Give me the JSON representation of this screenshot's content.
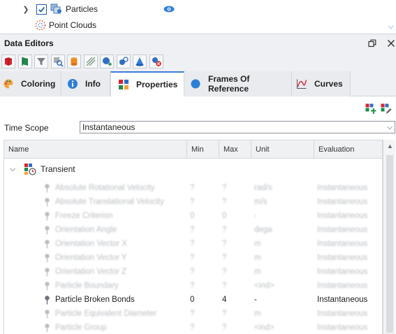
{
  "tree": {
    "items": [
      {
        "label": "Particles",
        "checked": true
      },
      {
        "label": "Point Clouds"
      }
    ]
  },
  "panel": {
    "title": "Data Editors"
  },
  "toolbar": {
    "buttons": [
      {
        "icon": "red-cube-icon"
      },
      {
        "icon": "green-flag-icon"
      },
      {
        "icon": "funnel-icon"
      },
      {
        "icon": "zoom-icon"
      },
      {
        "icon": "orange-cylinder-icon"
      },
      {
        "icon": "lines-icon"
      },
      {
        "icon": "add-node-icon"
      },
      {
        "icon": "link-icon"
      },
      {
        "icon": "cone-icon"
      },
      {
        "icon": "delete-icon"
      }
    ]
  },
  "tabs": [
    {
      "label": "Coloring",
      "active": false
    },
    {
      "label": "Info",
      "active": false
    },
    {
      "label": "Properties",
      "active": true
    },
    {
      "label": "Frames Of Reference",
      "active": false
    },
    {
      "label": "Curves",
      "active": false
    }
  ],
  "time_scope": {
    "label": "Time Scope",
    "value": "Instantaneous"
  },
  "grid": {
    "columns": [
      "Name",
      "Min",
      "Max",
      "Unit",
      "Evaluation"
    ],
    "group": "Transient",
    "rows": [
      {
        "name": "Absolute Rotational Velocity",
        "min": "?",
        "max": "?",
        "unit": "rad/s",
        "eval": "Instantaneous",
        "faded": true
      },
      {
        "name": "Absolute Translational Velocity",
        "min": "?",
        "max": "?",
        "unit": "m/s",
        "eval": "Instantaneous",
        "faded": true
      },
      {
        "name": "Freeze Criterion",
        "min": "0",
        "max": "0",
        "unit": "-",
        "eval": "Instantaneous",
        "faded": true
      },
      {
        "name": "Orientation Angle",
        "min": "?",
        "max": "?",
        "unit": "dega",
        "eval": "Instantaneous",
        "faded": true
      },
      {
        "name": "Orientation Vector X",
        "min": "?",
        "max": "?",
        "unit": "m",
        "eval": "Instantaneous",
        "faded": true
      },
      {
        "name": "Orientation Vector Y",
        "min": "?",
        "max": "?",
        "unit": "m",
        "eval": "Instantaneous",
        "faded": true
      },
      {
        "name": "Orientation Vector Z",
        "min": "?",
        "max": "?",
        "unit": "m",
        "eval": "Instantaneous",
        "faded": true
      },
      {
        "name": "Particle Boundary",
        "min": "?",
        "max": "?",
        "unit": "<ind>",
        "eval": "Instantaneous",
        "faded": true
      },
      {
        "name": "Particle Broken Bonds",
        "min": "0",
        "max": "4",
        "unit": "-",
        "eval": "Instantaneous",
        "faded": false
      },
      {
        "name": "Particle Equivalent Diameter",
        "min": "?",
        "max": "?",
        "unit": "m",
        "eval": "Instantaneous",
        "faded": true
      },
      {
        "name": "Particle Group",
        "min": "?",
        "max": "?",
        "unit": "<ind>",
        "eval": "Instantaneous",
        "faded": true
      }
    ]
  }
}
